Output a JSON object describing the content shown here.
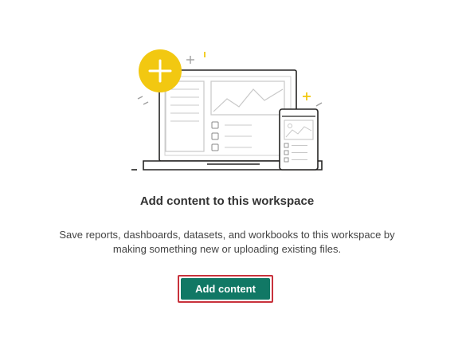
{
  "empty_state": {
    "illustration_icon": "laptop-and-phone-add-content-illustration",
    "heading": "Add content to this workspace",
    "description": "Save reports, dashboards, datasets, and workbooks to this workspace by making something new or uploading existing files.",
    "add_button_label": "Add content"
  },
  "colors": {
    "accent_yellow": "#F2C811",
    "button_green": "#117865",
    "highlight_red": "#C8323C",
    "line_gray": "#C8C8C8",
    "dark_outline": "#252423"
  }
}
